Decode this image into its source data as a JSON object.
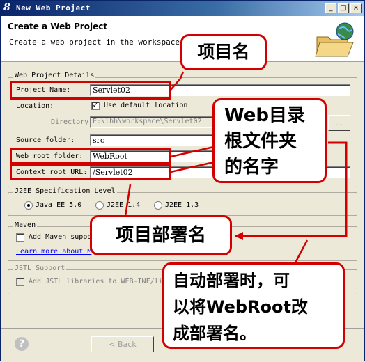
{
  "window": {
    "title": "New Web Project",
    "icon_glyph": "8",
    "minimize": "_",
    "maximize": "□",
    "close": "×"
  },
  "banner": {
    "title": "Create a Web Project",
    "description": "Create a web project in the workspace or"
  },
  "details_group": {
    "title": "Web Project Details",
    "project_name_label": "Project Name:",
    "project_name_value": "Servlet02",
    "location_label": "Location:",
    "use_default_location_label": "Use default location",
    "use_default_location_checked": true,
    "directory_label": "Directory:",
    "directory_value": "E:\\lhh\\workspace\\Servlet02",
    "browse_label": "...",
    "source_folder_label": "Source folder:",
    "source_folder_value": "src",
    "web_root_label": "Web root folder:",
    "web_root_value": "WebRoot",
    "context_root_label": "Context root URL:",
    "context_root_value": "/Servlet02"
  },
  "j2ee_group": {
    "title": "J2EE Specification Level",
    "options": [
      "Java EE 5.0",
      "J2EE 1.4",
      "J2EE 1.3"
    ],
    "selected": "Java EE 5.0"
  },
  "maven_group": {
    "title": "Maven",
    "add_maven_label": "Add Maven suppo",
    "learn_more_link": "Learn more about M"
  },
  "jstl_group": {
    "title": "JSTL Support",
    "add_jstl_label": "Add JSTL libraries to WEB-INF/li"
  },
  "footer": {
    "help_glyph": "?",
    "back_label": "< Back"
  },
  "annotations": {
    "project_name_callout": "项目名",
    "web_root_callout_lines": [
      "Web目录",
      "根文件夹",
      "的名字"
    ],
    "context_root_callout": "项目部署名",
    "deploy_callout_lines": [
      "自动部署时，可",
      "以将WebRoot改",
      "成部署名。"
    ],
    "highlight_color": "#d40000"
  }
}
